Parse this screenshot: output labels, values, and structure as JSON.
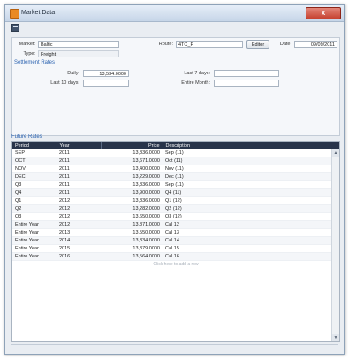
{
  "window": {
    "title": "Market Data",
    "close_label": "x"
  },
  "form": {
    "market_label": "Market:",
    "market_value": "Baltic",
    "type_label": "Type:",
    "type_value": "Freight",
    "route_label": "Route:",
    "route_value": "4TC_P",
    "editor_label": "Editor",
    "date_label": "Date:",
    "date_value": "09/09/2011",
    "settlement_title": "Settlement Rates",
    "daily_label": "Daily:",
    "daily_value": "13,534.0000",
    "last7_label": "Last 7 days:",
    "last7_value": "",
    "last10_label": "Last 10 days:",
    "last10_value": "",
    "entire_month_label": "Entire Month:",
    "entire_month_value": ""
  },
  "future_rates": {
    "title": "Future Rates",
    "columns": [
      "Period",
      "Year",
      "Price",
      "Description"
    ],
    "rows": [
      [
        "SEP",
        "2011",
        "13,836.0000",
        "Sep (11)"
      ],
      [
        "OCT",
        "2011",
        "13,671.0000",
        "Oct (11)"
      ],
      [
        "NOV",
        "2011",
        "13,400.0000",
        "Nov (11)"
      ],
      [
        "DEC",
        "2011",
        "13,229.0000",
        "Dec (11)"
      ],
      [
        "Q3",
        "2011",
        "13,836.0000",
        "Sep (11)"
      ],
      [
        "Q4",
        "2011",
        "13,900.0000",
        "Q4 (11)"
      ],
      [
        "Q1",
        "2012",
        "13,836.0000",
        "Q1 (12)"
      ],
      [
        "Q2",
        "2012",
        "13,282.0000",
        "Q2 (12)"
      ],
      [
        "Q3",
        "2012",
        "13,650.0000",
        "Q3 (12)"
      ],
      [
        "Entire Year",
        "2012",
        "13,871.0000",
        "Cal 12"
      ],
      [
        "Entire Year",
        "2013",
        "13,550.0000",
        "Cal 13"
      ],
      [
        "Entire Year",
        "2014",
        "13,334.0000",
        "Cal 14"
      ],
      [
        "Entire Year",
        "2015",
        "13,379.0000",
        "Cal 15"
      ],
      [
        "Entire Year",
        "2016",
        "13,564.0000",
        "Cal 16"
      ]
    ],
    "add_row_text": "Click here to add a row"
  }
}
